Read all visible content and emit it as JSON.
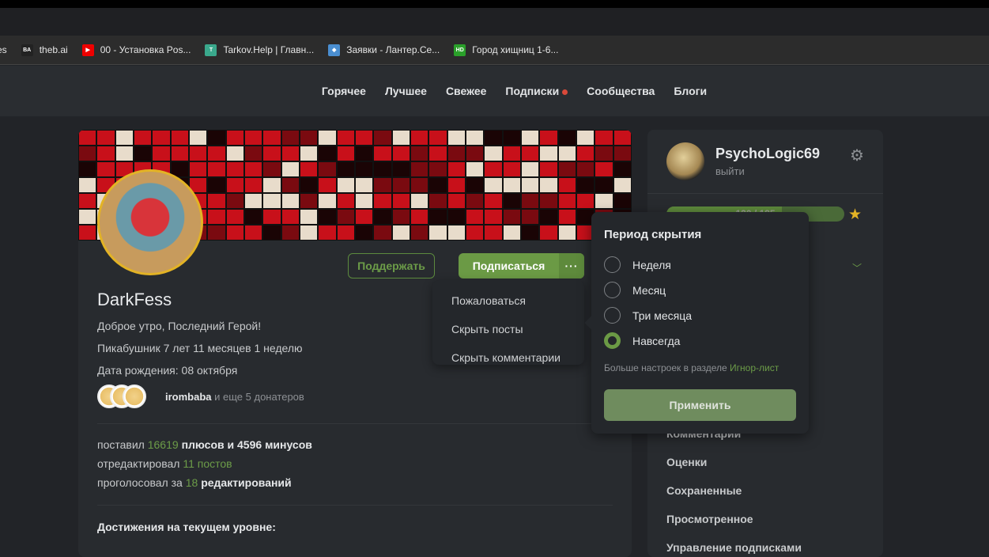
{
  "bookmarks": [
    {
      "label": "es",
      "icon": "none"
    },
    {
      "label": "theb.ai",
      "icon": "BA",
      "color": "#222"
    },
    {
      "label": "00 - Установка Pos...",
      "icon": "▶",
      "color": "#e00"
    },
    {
      "label": "Tarkov.Help | Главн...",
      "icon": "T",
      "color": "#3aa88c"
    },
    {
      "label": "Заявки - Лантер.Се...",
      "icon": "◆",
      "color": "#4a8ed0"
    },
    {
      "label": "Город хищниц 1-6...",
      "icon": "HD",
      "color": "#2aa02a"
    }
  ],
  "nav": [
    "Горячее",
    "Лучшее",
    "Свежее",
    "Подписки",
    "Сообщества",
    "Блоги"
  ],
  "profile": {
    "name": "DarkFess",
    "status": "Доброе утро, Последний Герой!",
    "tenure": "Пикабушник 7 лет 11 месяцев 1 неделю",
    "birthday": "Дата рождения: 08 октября",
    "donor_name": "irombaba",
    "donor_more": "и еще 5 донатеров",
    "support": "Поддержать",
    "subscribe": "Подписаться",
    "more": "···",
    "stats": {
      "l1a": "поставил",
      "plus": "16619",
      "l1b": "плюсов и",
      "minus": "4596",
      "l1c": "минусов",
      "l2a": "отредактировал",
      "posts": "11 постов",
      "l3a": "проголосовал за",
      "edits": "18",
      "l3b": "редактирований"
    },
    "achievements": "Достижения на текущем уровне:"
  },
  "menu": [
    "Пожаловаться",
    "Скрыть посты",
    "Скрыть комментарии"
  ],
  "sidebar": {
    "username": "PsychoLogic69",
    "logout": "выйти",
    "progress_text": "120 / 185",
    "progress_fraction": 0.65,
    "items": [
      "Комментарии",
      "Оценки",
      "Сохраненные",
      "Просмотренное",
      "Управление подписками"
    ]
  },
  "popover": {
    "title": "Период скрытия",
    "options": [
      "Неделя",
      "Месяц",
      "Три месяца",
      "Навсегда"
    ],
    "selected": 3,
    "more_text": "Больше настроек в разделе",
    "more_link": "Игнор-лист",
    "apply": "Применить"
  }
}
